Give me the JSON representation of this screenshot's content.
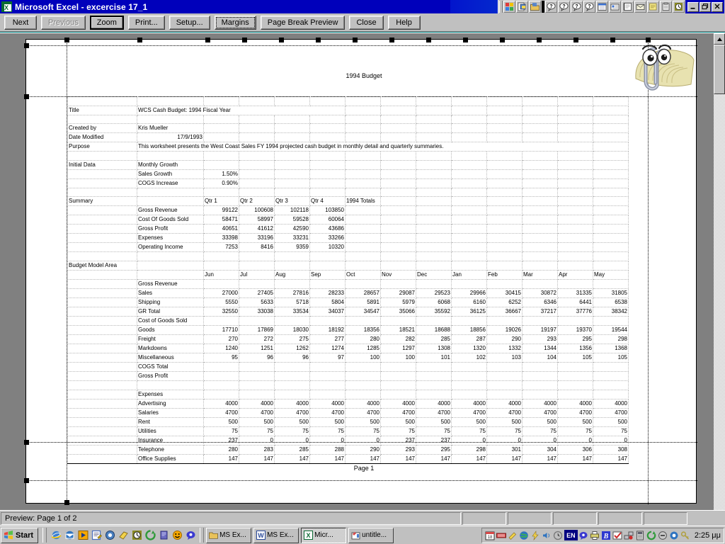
{
  "window": {
    "title": "Microsoft Excel - excercise 17_1",
    "app_icon": "excel-icon",
    "minimize_label": "_",
    "maximize_label": "❐",
    "close_label": "✕"
  },
  "preview_toolbar": {
    "buttons": [
      {
        "label": "Next",
        "accel": "N",
        "state": "normal",
        "name": "next-page-button"
      },
      {
        "label": "Previous",
        "accel": "P",
        "state": "disabled",
        "name": "previous-page-button"
      },
      {
        "label": "Zoom",
        "accel": "Z",
        "state": "default",
        "name": "zoom-button"
      },
      {
        "label": "Print...",
        "accel": "t",
        "state": "normal",
        "name": "print-button"
      },
      {
        "label": "Setup...",
        "accel": "S",
        "state": "normal",
        "name": "setup-button"
      },
      {
        "label": "Margins",
        "accel": "M",
        "state": "focused",
        "name": "margins-button"
      },
      {
        "label": "Page Break Preview",
        "accel": "v",
        "state": "normal",
        "name": "page-break-preview-button"
      },
      {
        "label": "Close",
        "accel": "C",
        "state": "normal",
        "name": "close-preview-button"
      },
      {
        "label": "Help",
        "accel": "H",
        "state": "normal",
        "name": "help-button"
      }
    ]
  },
  "office_shortcut_bar": {
    "icons": [
      "office-logo-icon",
      "new-office-document-icon",
      "open-office-document-icon",
      "answer-wizard-help-icon",
      "excel-help-icon",
      "word-help-icon",
      "office-help-icon",
      "schedule-icon",
      "contact-icon",
      "journal-icon",
      "mail-icon",
      "note-icon",
      "task-icon",
      "timer-icon"
    ]
  },
  "sheet": {
    "report_title": "1994 Budget",
    "page_footer": "Page 1",
    "header_rows": [
      {
        "label": "Title",
        "value": "WCS Cash Budget: 1994 Fiscal Year"
      },
      {
        "label": "Created by",
        "value": "Kris Mueller"
      },
      {
        "label": "Date Modified",
        "value": "17/9/1993"
      },
      {
        "label": "Purpose",
        "value": "This worksheet presents the West Coast Sales FY 1994 projected cash budget in monthly detail and quarterly summaries."
      }
    ],
    "initial_data": {
      "section_label": "Initial Data",
      "group_label": "Monthly Growth",
      "rows": [
        {
          "label": "Sales Growth",
          "value": "1.50%"
        },
        {
          "label": "COGS Increase",
          "value": "0.90%"
        }
      ]
    },
    "summary": {
      "section_label": "Summary",
      "columns": [
        "Qtr 1",
        "Qtr 2",
        "Qtr 3",
        "Qtr 4",
        "1994 Totals"
      ],
      "rows": [
        {
          "label": "Gross Revenue",
          "values": [
            "99122",
            "100608",
            "102118",
            "103850",
            ""
          ]
        },
        {
          "label": "Cost Of Goods Sold",
          "values": [
            "58471",
            "58997",
            "59528",
            "60064",
            ""
          ]
        },
        {
          "label": "Gross Profit",
          "values": [
            "40651",
            "41612",
            "42590",
            "43686",
            ""
          ]
        },
        {
          "label": "Expenses",
          "values": [
            "33398",
            "33196",
            "33231",
            "33266",
            ""
          ]
        },
        {
          "label": "Operating Income",
          "values": [
            "7253",
            "8416",
            "9359",
            "10320",
            ""
          ]
        }
      ]
    },
    "budget_model": {
      "section_label": "Budget Model Area",
      "months": [
        "Jun",
        "Jul",
        "Aug",
        "Sep",
        "Oct",
        "Nov",
        "Dec",
        "Jan",
        "Feb",
        "Mar",
        "Apr",
        "May"
      ],
      "groups": [
        {
          "title": "Gross Revenue",
          "rows": [
            {
              "label": "Sales",
              "values": [
                "27000",
                "27405",
                "27816",
                "28233",
                "28657",
                "29087",
                "29523",
                "29966",
                "30415",
                "30872",
                "31335",
                "31805"
              ]
            },
            {
              "label": "Shipping",
              "values": [
                "5550",
                "5633",
                "5718",
                "5804",
                "5891",
                "5979",
                "6068",
                "6160",
                "6252",
                "6346",
                "6441",
                "6538"
              ]
            },
            {
              "label": "GR Total",
              "values": [
                "32550",
                "33038",
                "33534",
                "34037",
                "34547",
                "35066",
                "35592",
                "36125",
                "36667",
                "37217",
                "37776",
                "38342"
              ]
            }
          ]
        },
        {
          "title": "Cost of Goods Sold",
          "rows": [
            {
              "label": "Goods",
              "values": [
                "17710",
                "17869",
                "18030",
                "18192",
                "18356",
                "18521",
                "18688",
                "18856",
                "19026",
                "19197",
                "19370",
                "19544"
              ]
            },
            {
              "label": "Freight",
              "values": [
                "270",
                "272",
                "275",
                "277",
                "280",
                "282",
                "285",
                "287",
                "290",
                "293",
                "295",
                "298"
              ]
            },
            {
              "label": "Markdowns",
              "values": [
                "1240",
                "1251",
                "1262",
                "1274",
                "1285",
                "1297",
                "1308",
                "1320",
                "1332",
                "1344",
                "1356",
                "1368"
              ]
            },
            {
              "label": "Miscellaneous",
              "values": [
                "95",
                "96",
                "96",
                "97",
                "100",
                "100",
                "101",
                "102",
                "103",
                "104",
                "105",
                "105"
              ]
            }
          ]
        },
        {
          "title": "",
          "rows": [
            {
              "label": "COGS Total",
              "values": [
                "",
                "",
                "",
                "",
                "",
                "",
                "",
                "",
                "",
                "",
                "",
                ""
              ]
            },
            {
              "label": "Gross Profit",
              "values": [
                "",
                "",
                "",
                "",
                "",
                "",
                "",
                "",
                "",
                "",
                "",
                ""
              ]
            }
          ]
        },
        {
          "title": "Expenses",
          "rows": [
            {
              "label": "Advertising",
              "values": [
                "4000",
                "4000",
                "4000",
                "4000",
                "4000",
                "4000",
                "4000",
                "4000",
                "4000",
                "4000",
                "4000",
                "4000"
              ]
            },
            {
              "label": "Salaries",
              "values": [
                "4700",
                "4700",
                "4700",
                "4700",
                "4700",
                "4700",
                "4700",
                "4700",
                "4700",
                "4700",
                "4700",
                "4700"
              ]
            },
            {
              "label": "Rent",
              "values": [
                "500",
                "500",
                "500",
                "500",
                "500",
                "500",
                "500",
                "500",
                "500",
                "500",
                "500",
                "500"
              ]
            },
            {
              "label": "Utilities",
              "values": [
                "75",
                "75",
                "75",
                "75",
                "75",
                "75",
                "75",
                "75",
                "75",
                "75",
                "75",
                "75"
              ]
            },
            {
              "label": "Insurance",
              "values": [
                "237",
                "0",
                "0",
                "0",
                "0",
                "237",
                "237",
                "0",
                "0",
                "0",
                "0",
                "0"
              ]
            },
            {
              "label": "Telephone",
              "values": [
                "280",
                "283",
                "285",
                "288",
                "290",
                "293",
                "295",
                "298",
                "301",
                "304",
                "306",
                "308"
              ]
            },
            {
              "label": "Office Supplies",
              "values": [
                "147",
                "147",
                "147",
                "147",
                "147",
                "147",
                "147",
                "147",
                "147",
                "147",
                "147",
                "147"
              ]
            }
          ]
        }
      ]
    }
  },
  "assistant": {
    "name": "office-assistant-clippy"
  },
  "status_bar": {
    "text": "Preview: Page 1 of 2"
  },
  "taskbar": {
    "start_label": "Start",
    "quick_launch": [
      "internet-explorer-icon",
      "outlook-express-icon",
      "media-player-icon",
      "notepad-icon",
      "show-desktop-icon",
      "winzip-icon",
      "clock-icon",
      "recycle-icon",
      "folder-icon",
      "smiley-icon",
      "messenger-icon"
    ],
    "tasks": [
      {
        "label": "MS Ex...",
        "icon": "folder-icon",
        "active": false
      },
      {
        "label": "MS Ex...",
        "icon": "word-icon",
        "active": false
      },
      {
        "label": "Micr...",
        "icon": "excel-icon",
        "active": true
      },
      {
        "label": "untitle...",
        "icon": "paint-icon",
        "active": false
      }
    ],
    "tray_icons": [
      "calendar-icon",
      "keyboard-icon",
      "pencil-icon",
      "globe-icon",
      "lightning-icon",
      "volume-icon",
      "monitor-icon"
    ],
    "language": "EN",
    "tray_icons_2": [
      "speech-icon",
      "printer-icon",
      "bold-icon",
      "checkmark-icon",
      "network-icon",
      "calculator-icon",
      "refresh-icon",
      "power-icon",
      "antivirus-icon",
      "key-icon"
    ],
    "clock": "2:25 μμ"
  },
  "colors": {
    "title_bar": "#0000bb",
    "desktop": "#008080",
    "chrome": "#c0c0c0",
    "preview_bg": "#808080",
    "page": "#ffffff"
  }
}
